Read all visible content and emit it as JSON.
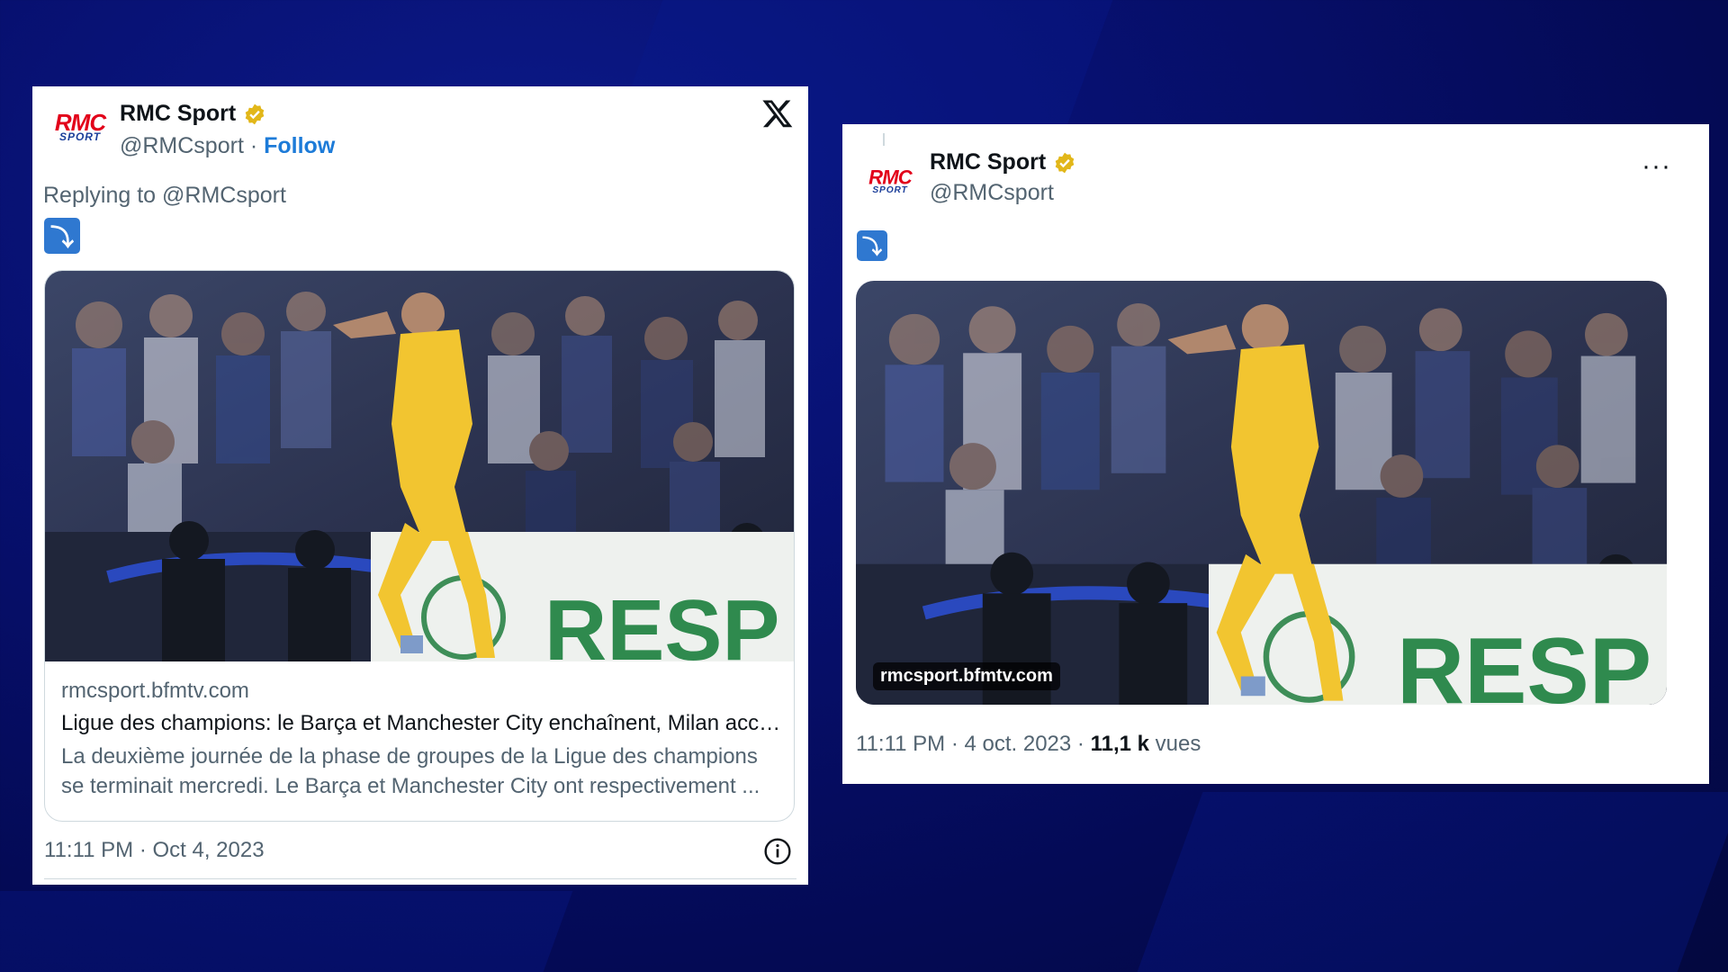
{
  "left_tweet": {
    "author_name": "RMC Sport",
    "author_handle": "@RMCsport",
    "separator": "·",
    "follow_label": "Follow",
    "logo_text_top": "RMC",
    "logo_text_bottom": "SPORT",
    "replying_to": "Replying to @RMCsport",
    "reply_emoji": "⤵",
    "link_domain": "rmcsport.bfmtv.com",
    "link_title": "Ligue des champions: le Barça et Manchester City enchaînent, Milan accr...",
    "link_description_line1": "La deuxième journée de la phase de groupes de la Ligue des champions",
    "link_description_line2": "se terminait mercredi. Le Barça et Manchester City ont respectivement ...",
    "banner_text": "RESP",
    "timestamp": "11:11 PM · Oct 4, 2023"
  },
  "right_tweet": {
    "author_name": "RMC Sport",
    "author_handle": "@RMCsport",
    "logo_text_top": "RMC",
    "logo_text_bottom": "SPORT",
    "reply_emoji": "⤵",
    "more_label": "···",
    "image_domain": "rmcsport.bfmtv.com",
    "banner_text": "RESP",
    "timestamp": "11:11 PM · 4 oct. 2023 · ",
    "views_count": "11,1 k",
    "views_label": " vues"
  },
  "colors": {
    "background": "#050d66",
    "verified_gold": "#e2b719",
    "follow_blue": "#1d7bd8",
    "jersey_yellow": "#f2c530",
    "emoji_blue": "#2f78d0"
  }
}
